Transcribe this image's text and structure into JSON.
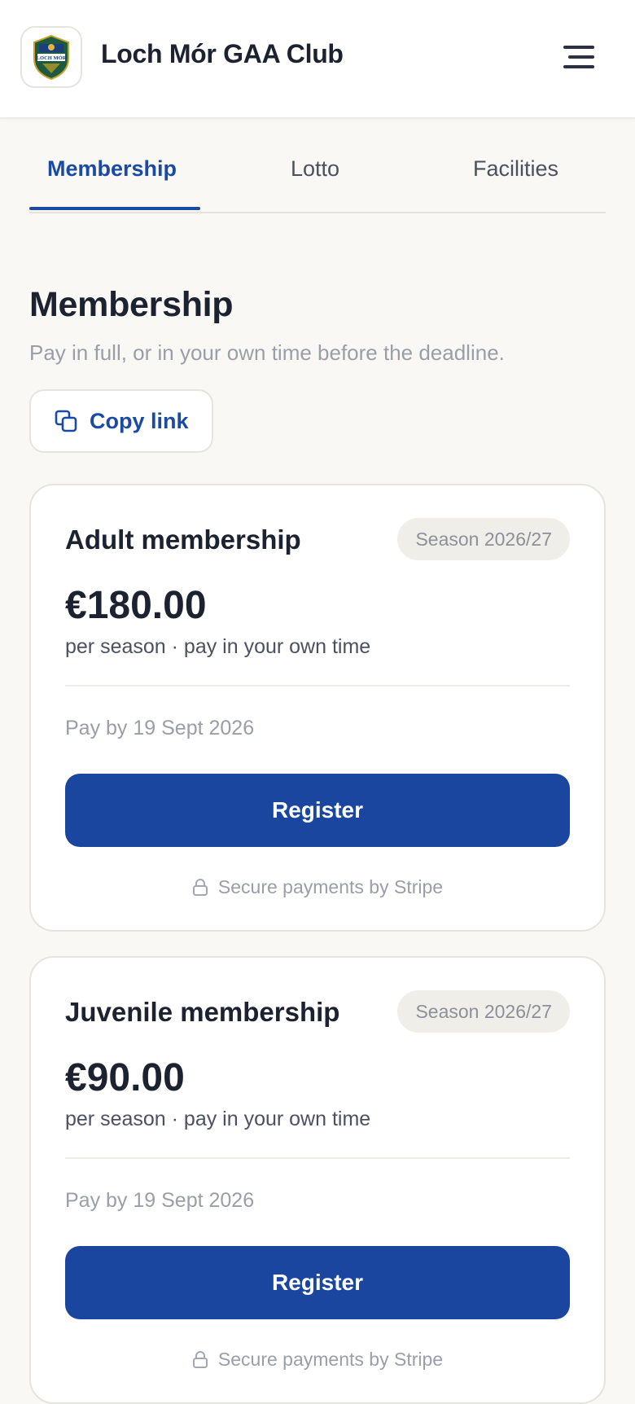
{
  "header": {
    "club_name": "Loch Mór GAA Club",
    "logo_text": "LOCH MÓR",
    "menu_icon": "hamburger-menu-icon"
  },
  "tabs": [
    {
      "label": "Membership",
      "active": true
    },
    {
      "label": "Lotto",
      "active": false
    },
    {
      "label": "Facilities",
      "active": false
    }
  ],
  "page": {
    "title": "Membership",
    "subtitle": "Pay in full, or in your own time before the deadline.",
    "copy_link_label": "Copy link",
    "copy_icon": "copy-icon"
  },
  "memberships": [
    {
      "title": "Adult membership",
      "badge": "Season 2026/27",
      "price": "€180.00",
      "price_note": "per season · pay in your own time",
      "deadline": "Pay by 19 Sept 2026",
      "button": "Register",
      "secure_note": "Secure payments by Stripe"
    },
    {
      "title": "Juvenile membership",
      "badge": "Season 2026/27",
      "price": "€90.00",
      "price_note": "per season · pay in your own time",
      "deadline": "Pay by 19 Sept 2026",
      "button": "Register",
      "secure_note": "Secure payments by Stripe"
    }
  ],
  "colors": {
    "accent": "#1a46a0",
    "background": "#f9f8f5",
    "card": "#ffffff",
    "muted_text": "#9a9ea8"
  }
}
